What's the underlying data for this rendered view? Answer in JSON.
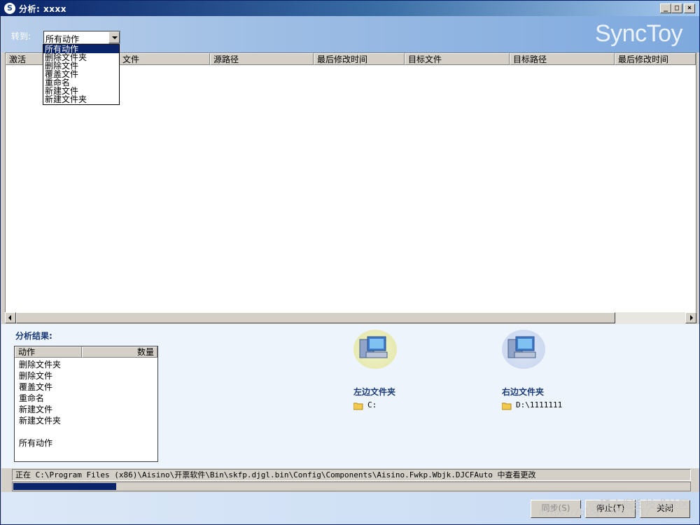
{
  "window": {
    "title": "分析: xxxx",
    "controls": {
      "minimize": "_",
      "maximize": "□",
      "close": "×"
    }
  },
  "header": {
    "goto_label": "转到:",
    "goto_selected": "所有动作",
    "brand": "SyncToy"
  },
  "dropdown": {
    "options": [
      "所有动作",
      "删除文件夹",
      "删除文件",
      "覆盖文件",
      "重命名",
      "新建文件",
      "新建文件夹"
    ],
    "selected_index": 0
  },
  "list": {
    "columns": [
      "激活",
      "文件",
      "源路径",
      "最后修改时间",
      "目标文件",
      "目标路径",
      "最后修改时间"
    ]
  },
  "results": {
    "title": "分析结果:",
    "table_headers": {
      "action": "动作",
      "count": "数量"
    },
    "rows": [
      "删除文件夹",
      "删除文件",
      "覆盖文件",
      "重命名",
      "新建文件",
      "新建文件夹"
    ],
    "total_label": "所有动作"
  },
  "left_folder": {
    "title": "左边文件夹",
    "path": "C:"
  },
  "right_folder": {
    "title": "右边文件夹",
    "path": "D:\\1111111"
  },
  "status": {
    "text": "正在 C:\\Program Files (x86)\\Aisino\\开票软件\\Bin\\skfp.djgl.bin\\Config\\Components\\Aisino.Fwkp.Wbjk.DJCFAuto 中查看更改",
    "progress_fraction": 0.152
  },
  "buttons": {
    "sync": "同步(S)",
    "stop": "停止(T)",
    "close": "关闭"
  },
  "watermark": {
    "line1": "@稀土掘金技术社区",
    "line2": "https://blog.csdn.net/"
  },
  "colors": {
    "title_bar": "#0a246a",
    "accent": "#1a3a78",
    "progress": "#0a246a"
  },
  "icons": {
    "title": "synctoy-icon",
    "left_pc": "computer-icon",
    "right_pc": "computer-icon",
    "folder": "folder-icon"
  }
}
